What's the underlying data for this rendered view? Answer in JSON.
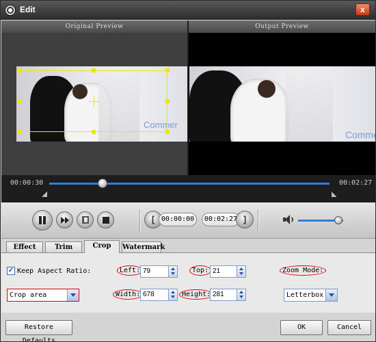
{
  "window": {
    "title": "Edit",
    "close_glyph": "x"
  },
  "preview": {
    "original_label": "Original Preview",
    "output_label": "Output Preview",
    "watermark_text": "Commer"
  },
  "timeline": {
    "current_time": "00:00:30",
    "total_time": "00:02:27",
    "progress": 0.19
  },
  "controls": {
    "start_marker_label": "[",
    "start_time": "00:00:00",
    "end_time": "00:02:27",
    "end_marker_label": "]",
    "volume_level": 0.9
  },
  "tabs": [
    {
      "label": "Effect",
      "active": false
    },
    {
      "label": "Trim",
      "active": false
    },
    {
      "label": "Crop",
      "active": true
    },
    {
      "label": "Watermark",
      "active": false
    }
  ],
  "crop": {
    "keep_aspect_label": "Keep Aspect Ratio:",
    "keep_aspect_checked": true,
    "left_label": "Left:",
    "left_value": "79",
    "top_label": "Top:",
    "top_value": "21",
    "width_label": "Width:",
    "width_value": "678",
    "height_label": "Height:",
    "height_value": "281",
    "zoom_mode_label": "Zoom Mode:",
    "zoom_mode_value": "Letterbox",
    "crop_area_value": "Crop area"
  },
  "footer": {
    "restore_label": "Restore Defaults",
    "ok_label": "OK",
    "cancel_label": "Cancel"
  },
  "colors": {
    "accent": "#2f7fd9",
    "crop_frame": "#e8e800",
    "highlight_circle": "#e00000"
  }
}
